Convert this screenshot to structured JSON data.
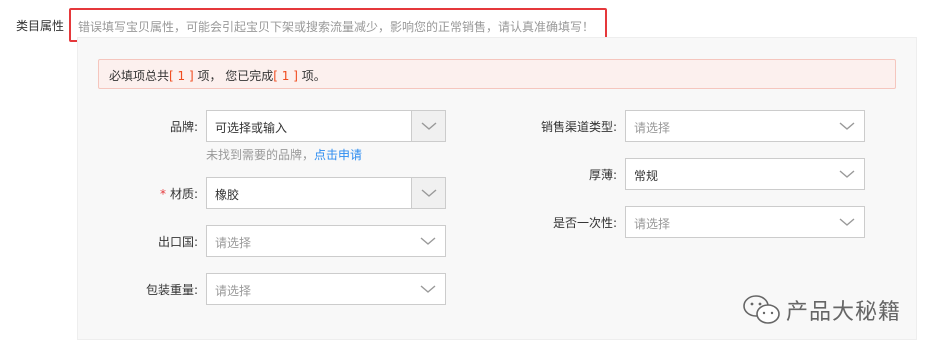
{
  "section_label": "类目属性",
  "warning": "错误填写宝贝属性，可能会引起宝贝下架或搜索流量减少，影响您的正常销售，请认真准确填写！",
  "notice": {
    "prefix": "必填项总共",
    "total": "[ 1 ]",
    "middle": " 项，   您已完成",
    "done": "[ 1 ]",
    "suffix": " 项。"
  },
  "left_fields": {
    "brand": {
      "label": "品牌:",
      "value": "可选择或输入",
      "placeholder": false
    },
    "material": {
      "required_mark": "*",
      "label": "材质:",
      "value": "橡胶"
    },
    "export_country": {
      "label": "出口国:",
      "value": "请选择"
    },
    "package_weight": {
      "label": "包装重量:",
      "value": "请选择"
    }
  },
  "brand_hint": {
    "text": "未找到需要的品牌，",
    "link": "点击申请"
  },
  "right_fields": {
    "sales_channel": {
      "label": "销售渠道类型:",
      "value": "请选择"
    },
    "thickness": {
      "label": "厚薄:",
      "value": "常规"
    },
    "disposable": {
      "label": "是否一次性:",
      "value": "请选择"
    }
  },
  "watermark": {
    "text": "产品大秘籍",
    "icon": "wechat-icon"
  },
  "colors": {
    "accent_red": "#e5383b",
    "highlight": "#f04b1f",
    "link": "#2d8cf0"
  }
}
